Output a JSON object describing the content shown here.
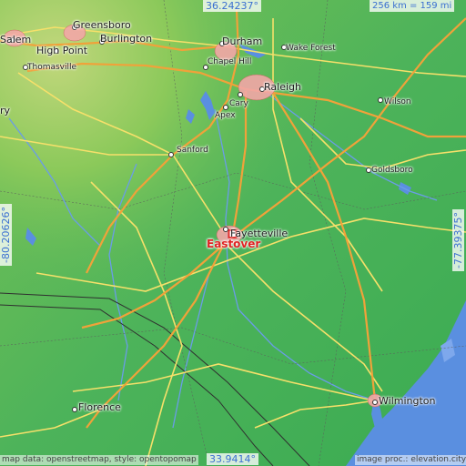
{
  "map": {
    "colors": {
      "terrain_low": "#43b04f",
      "terrain_mid": "#6fc24a",
      "terrain_high": "#b9d47a",
      "highway": "#f0a23a",
      "primary_road": "#f6e06a",
      "water": "#5a8fe0",
      "boundary": "#4a4a4a",
      "marker": "#e02323"
    },
    "target_place": "Eastover",
    "coordinates": {
      "top": "36.24237°",
      "bottom": "33.9414°",
      "left": "-80.20626°",
      "right": "-77.39375°",
      "scale": "256 km = 159 mi"
    },
    "cities": [
      {
        "name": "Greensboro"
      },
      {
        "name": "Salem"
      },
      {
        "name": "Burlington"
      },
      {
        "name": "High Point"
      },
      {
        "name": "Thomasville"
      },
      {
        "name": "Durham"
      },
      {
        "name": "Wake Forest"
      },
      {
        "name": "Chapel Hill"
      },
      {
        "name": "Raleigh"
      },
      {
        "name": "Cary"
      },
      {
        "name": "Apex"
      },
      {
        "name": "Wilson"
      },
      {
        "name": "Sanford"
      },
      {
        "name": "Goldsboro"
      },
      {
        "name": "ry"
      },
      {
        "name": "Fayetteville"
      },
      {
        "name": "Florence"
      },
      {
        "name": "Wilmington"
      }
    ],
    "credits": {
      "left": "map data: openstreetmap, style: opentopomap",
      "right": "image proc.: elevation.city"
    }
  }
}
